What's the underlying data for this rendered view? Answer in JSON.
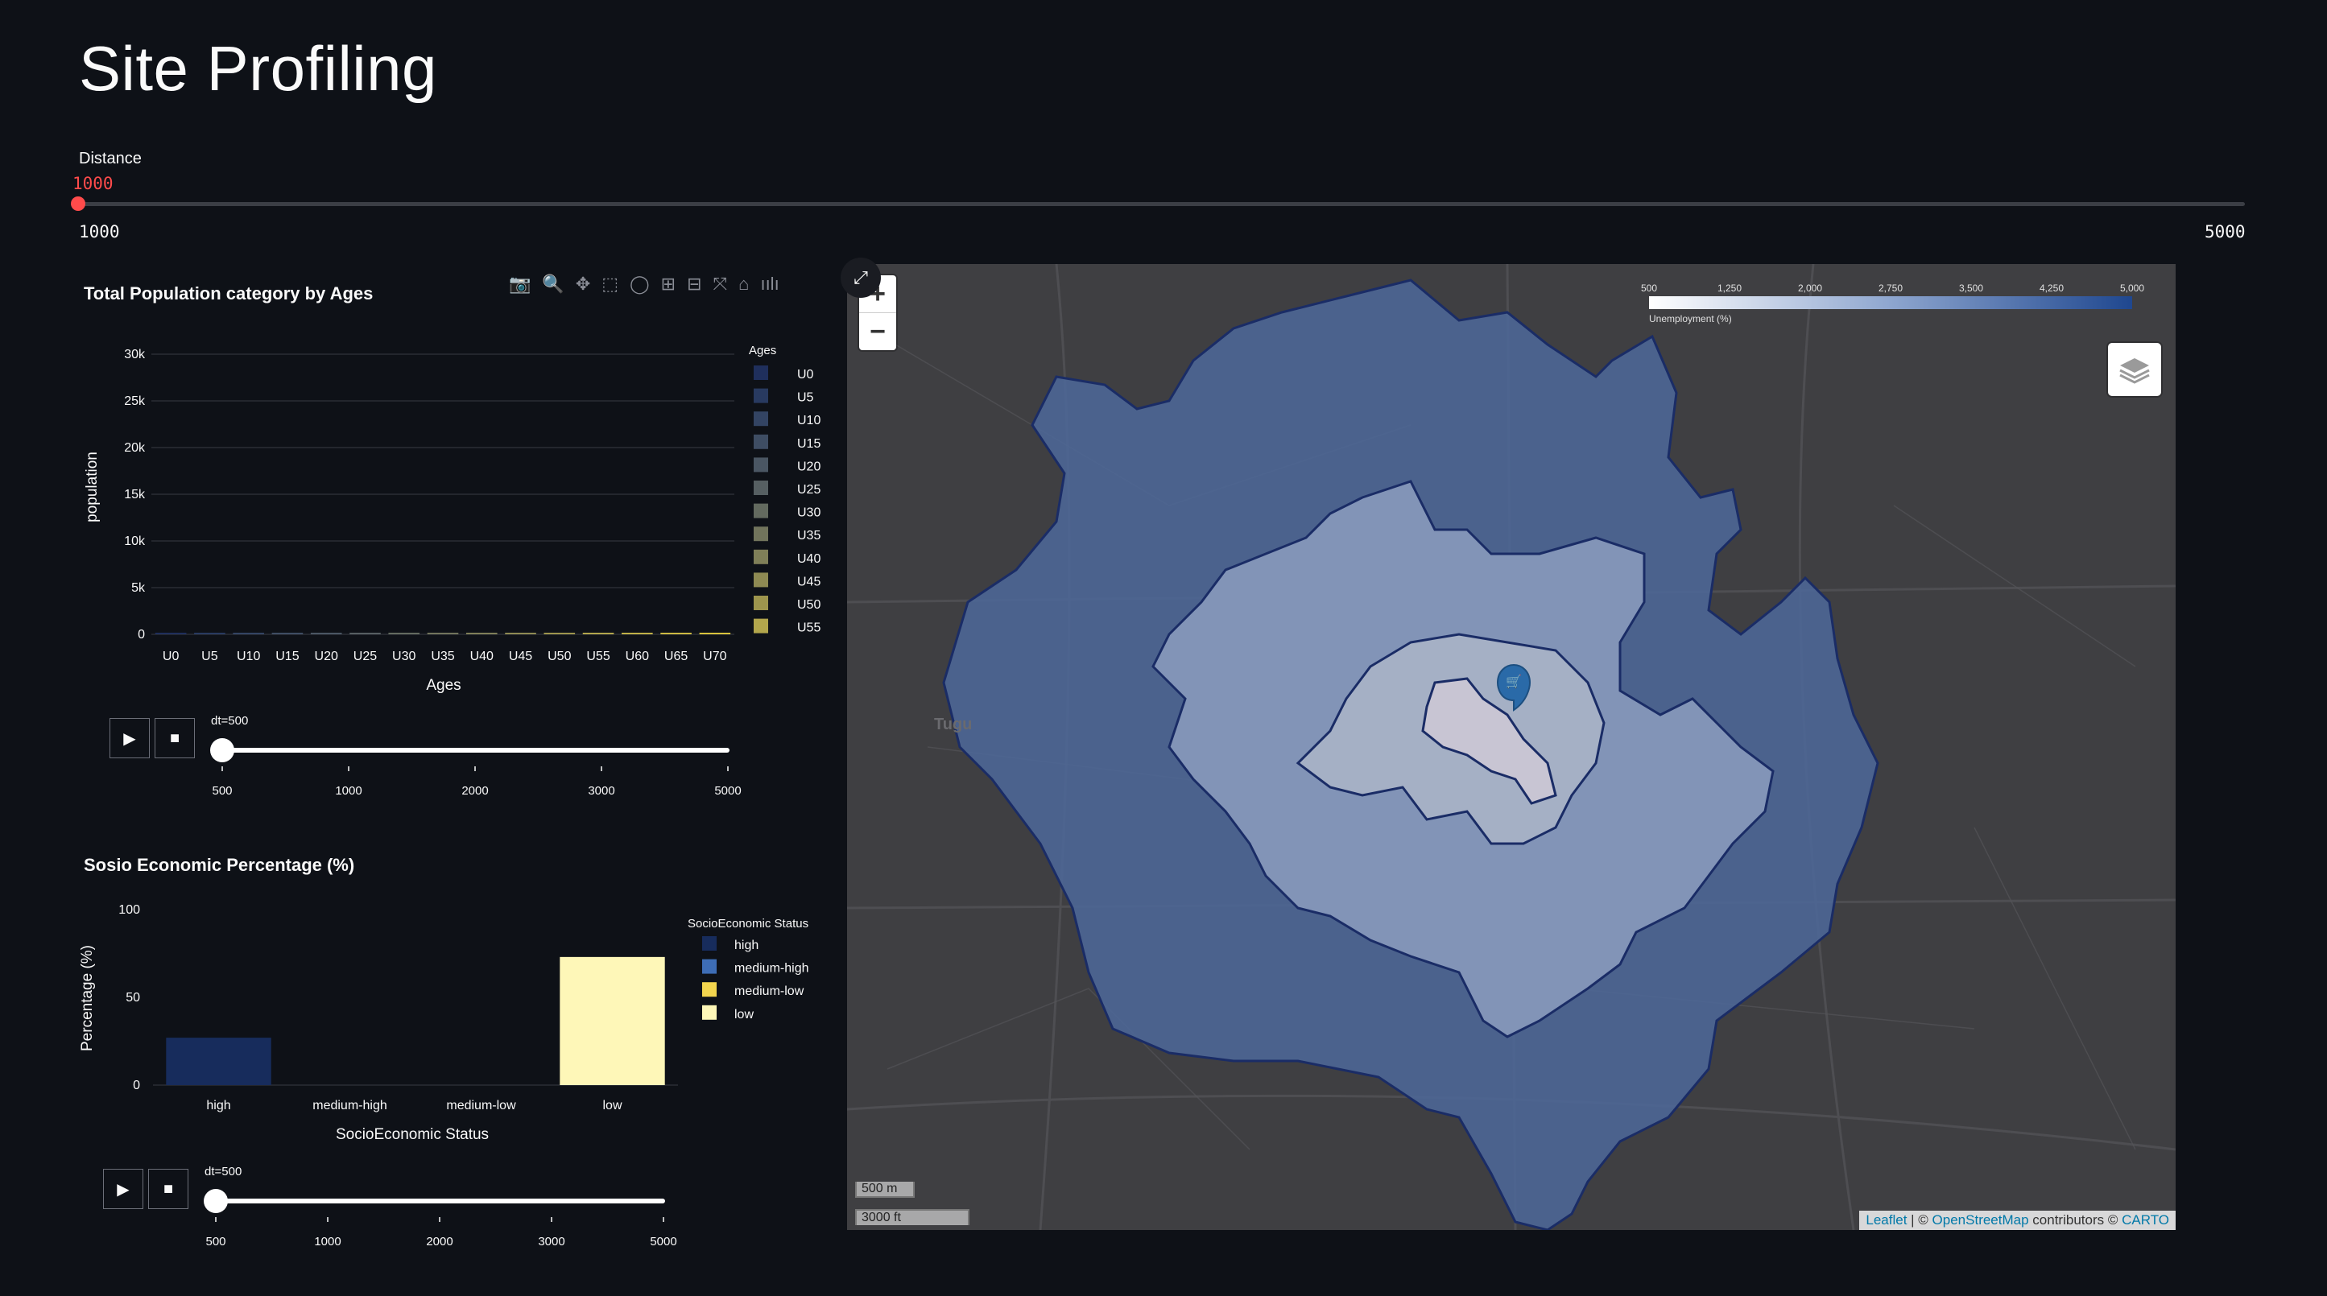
{
  "page": {
    "title": "Site Profiling"
  },
  "distance_slider": {
    "label": "Distance",
    "value": "1000",
    "min": "1000",
    "max": "5000"
  },
  "population_chart": {
    "title": "Total Population category by Ages",
    "modebar_icons": [
      "camera-icon",
      "zoom-icon",
      "pan-icon",
      "box-select-icon",
      "lasso-select-icon",
      "zoom-in-icon",
      "zoom-out-icon",
      "autoscale-icon",
      "reset-axes-icon",
      "plotly-logo-icon"
    ],
    "animation": {
      "label": "dt=500",
      "play_label": "▶",
      "stop_label": "■",
      "steps": [
        "500",
        "1000",
        "2000",
        "3000",
        "5000"
      ]
    }
  },
  "socio_chart": {
    "title": "Sosio Economic Percentage (%)",
    "animation": {
      "label": "dt=500",
      "play_label": "▶",
      "stop_label": "■",
      "steps": [
        "500",
        "1000",
        "2000",
        "3000",
        "5000"
      ]
    }
  },
  "chart_data": [
    {
      "type": "bar",
      "title": "Total Population category by Ages",
      "xlabel": "Ages",
      "ylabel": "population",
      "ylim": [
        0,
        30000
      ],
      "yticks": [
        0,
        5000,
        10000,
        15000,
        20000,
        25000,
        30000
      ],
      "ytick_labels": [
        "0",
        "5k",
        "10k",
        "15k",
        "20k",
        "25k",
        "30k"
      ],
      "categories": [
        "U0",
        "U5",
        "U10",
        "U15",
        "U20",
        "U25",
        "U30",
        "U35",
        "U40",
        "U45",
        "U50",
        "U55",
        "U60",
        "U65",
        "U70"
      ],
      "values": [
        50,
        60,
        70,
        80,
        90,
        100,
        110,
        120,
        130,
        140,
        150,
        150,
        150,
        140,
        130
      ],
      "legend_title": "Ages",
      "legend_position": "right",
      "legend_entries": [
        "U0",
        "U5",
        "U10",
        "U15",
        "U20",
        "U25",
        "U30",
        "U35",
        "U40",
        "U45",
        "U50",
        "U55"
      ],
      "colors": [
        "#1f2f5c",
        "#283a60",
        "#334463",
        "#3e4d63",
        "#4a5663",
        "#565f62",
        "#636a5f",
        "#71745c",
        "#7f7f58",
        "#8e8a53",
        "#9d954d",
        "#b2a64c",
        "#c0b047",
        "#ccb942",
        "#d8c23c"
      ],
      "grid": true
    },
    {
      "type": "bar",
      "title": "Sosio Economic Percentage (%)",
      "xlabel": "SocioEconomic Status",
      "ylabel": "Percentage (%)",
      "ylim": [
        0,
        100
      ],
      "yticks": [
        0,
        50,
        100
      ],
      "categories": [
        "high",
        "medium-high",
        "medium-low",
        "low"
      ],
      "values": [
        27,
        0,
        0,
        73
      ],
      "legend_title": "SocioEconomic Status",
      "legend_position": "right",
      "legend_entries": [
        "high",
        "medium-high",
        "medium-low",
        "low"
      ],
      "colors": [
        "#172c5c",
        "#3e6db5",
        "#f3d54e",
        "#fef7b8"
      ],
      "grid": false
    }
  ],
  "map": {
    "colorbar": {
      "ticks": [
        "500",
        "1,250",
        "2,000",
        "2,750",
        "3,500",
        "4,250",
        "5,000"
      ],
      "label": "Unemployment (%)"
    },
    "place_labels": [
      "Tugu"
    ],
    "scale": {
      "metric": "500 m",
      "imperial": "3000 ft"
    },
    "zoom_in": "+",
    "zoom_out": "−",
    "attribution": {
      "leaflet": "Leaflet",
      "osm": "OpenStreetMap",
      "contributors": "contributors ©",
      "carto": "CARTO"
    }
  }
}
